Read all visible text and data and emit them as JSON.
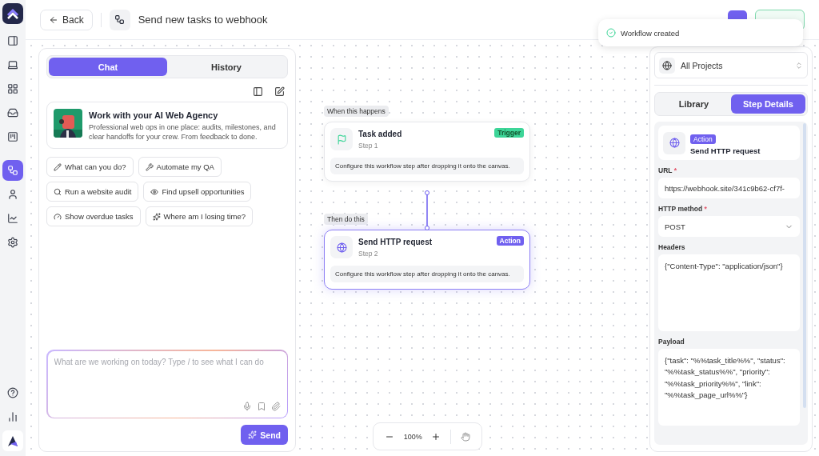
{
  "sidebar": {
    "nav": [
      {
        "kind": "panel",
        "selected": false
      },
      {
        "kind": "laptop",
        "selected": false
      },
      {
        "kind": "grid",
        "selected": false
      },
      {
        "kind": "inbox",
        "selected": false
      },
      {
        "kind": "board",
        "selected": false
      },
      {
        "kind": "workflow",
        "selected": true
      },
      {
        "kind": "user",
        "selected": false
      },
      {
        "kind": "chart",
        "selected": false
      },
      {
        "kind": "settings",
        "selected": false
      }
    ],
    "bottom": [
      {
        "kind": "help",
        "selected": false
      },
      {
        "kind": "bars",
        "selected": false
      }
    ]
  },
  "header": {
    "back": "Back",
    "title": "Send new tasks to webhook"
  },
  "toast": {
    "message": "Workflow created"
  },
  "chat": {
    "tabs": [
      {
        "label": "Chat",
        "selected": true
      },
      {
        "label": "History",
        "selected": false
      }
    ],
    "intro": {
      "title": "Work with your AI Web Agency",
      "text": "Professional web ops in one place: audits, milestones, and clear handoffs for your crew. From feedback to done."
    },
    "suggestion_rows": [
      [
        {
          "kind": "pencil",
          "label": "What can you do?"
        },
        {
          "kind": "wrench",
          "label": "Automate my QA"
        }
      ],
      [
        {
          "kind": "search",
          "label": "Run a website audit"
        },
        {
          "kind": "eye",
          "label": "Find upsell opportunities"
        }
      ],
      [
        {
          "kind": "gauge",
          "label": "Show overdue tasks"
        },
        {
          "kind": "sparkle",
          "label": "Where am I losing time?"
        }
      ]
    ],
    "input": {
      "placeholder": "What are we working on today? Type / to see what I can do"
    },
    "send": "Send"
  },
  "canvas": {
    "steps": [
      {
        "group": "When this happens",
        "title": "Task added",
        "step": "Step 1",
        "badge": "Trigger",
        "kind": "trigger",
        "selected": false,
        "text": "Configure this workflow step after dropping it onto the canvas."
      },
      {
        "group": "Then do this",
        "title": "Send HTTP request",
        "step": "Step 2",
        "badge": "Action",
        "kind": "action",
        "selected": true,
        "text": "Configure this workflow step after dropping it onto the canvas."
      }
    ],
    "zoom": "100%"
  },
  "details": {
    "project": "All Projects",
    "tabs": [
      {
        "label": "Library",
        "selected": false
      },
      {
        "label": "Step Details",
        "selected": true
      }
    ],
    "step": {
      "badge": "Action",
      "title": "Send HTTP request"
    },
    "fields": [
      {
        "kind": "input",
        "label": "URL",
        "marker": "*",
        "value": "https://webhook.site/341c9b62-cf7f-"
      },
      {
        "kind": "select",
        "label": "HTTP method",
        "marker": "*",
        "value": "POST"
      },
      {
        "kind": "textarea",
        "label": "Headers",
        "value": "{\"Content-Type\": \"application/json\"}"
      },
      {
        "kind": "textarea",
        "label": "Payload",
        "value": "{\"task\": \"%%task_title%%\", \"status\": \"%%task_status%%\", \"priority\": \"%%task_priority%%\", \"link\": \"%%task_page_url%%\"}"
      }
    ]
  }
}
